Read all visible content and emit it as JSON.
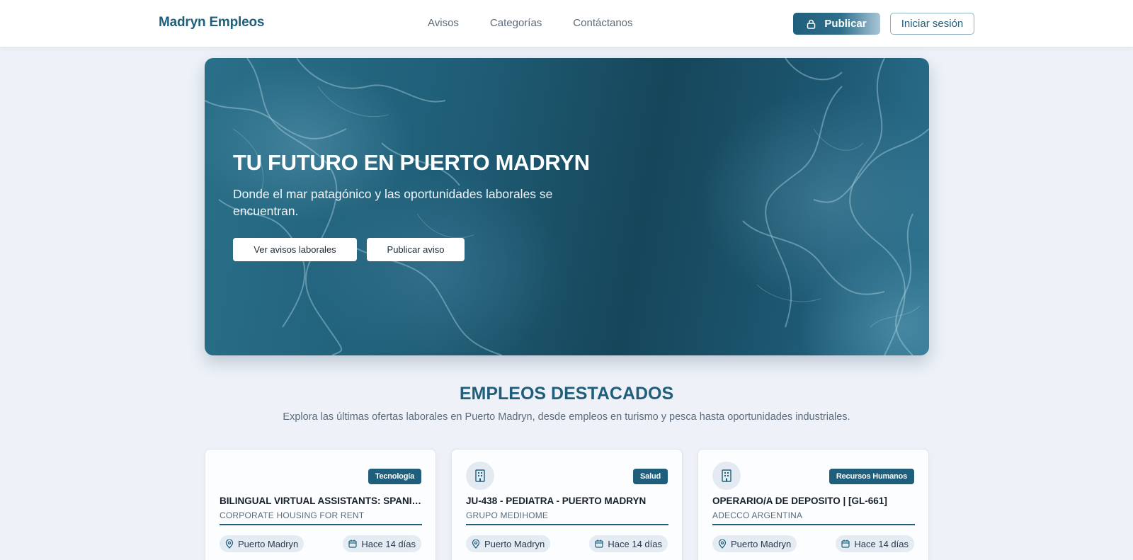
{
  "navbar": {
    "brand": "Madryn Empleos",
    "links": [
      "Avisos",
      "Categorías",
      "Contáctanos"
    ],
    "publish_label": "Publicar",
    "login_label": "Iniciar sesión"
  },
  "hero": {
    "title": "TU FUTURO EN PUERTO MADRYN",
    "subtitle": "Donde el mar patagónico y las oportunidades laborales se encuentran.",
    "btn_primary": "Ver avisos laborales",
    "btn_secondary": "Publicar aviso"
  },
  "featured": {
    "title": "EMPLEOS DESTACADOS",
    "subtitle": "Explora las últimas ofertas laborales en Puerto Madryn, desde empleos en turismo y pesca hasta oportunidades industriales."
  },
  "jobs": [
    {
      "category": "Tecnología",
      "title": "BILINGUAL VIRTUAL ASSISTANTS: SPANISH/…",
      "company": "CORPORATE HOUSING FOR RENT",
      "location": "Puerto Madryn",
      "posted": "Hace 14 días",
      "has_icon": false
    },
    {
      "category": "Salud",
      "title": "JU-438 - PEDIATRA - PUERTO MADRYN",
      "company": "GRUPO MEDIHOME",
      "location": "Puerto Madryn",
      "posted": "Hace 14 días",
      "has_icon": true
    },
    {
      "category": "Recursos Humanos",
      "title": "OPERARIO/A DE DEPOSITO | [GL-661]",
      "company": "ADECCO ARGENTINA",
      "location": "Puerto Madryn",
      "posted": "Hace 14 días",
      "has_icon": true
    }
  ],
  "colors": {
    "primary": "#1f5f7c",
    "background": "#eef2f8",
    "text_muted": "#5b6b7b"
  },
  "icons": [
    "lock-icon",
    "building-icon",
    "map-pin-icon",
    "calendar-icon"
  ]
}
